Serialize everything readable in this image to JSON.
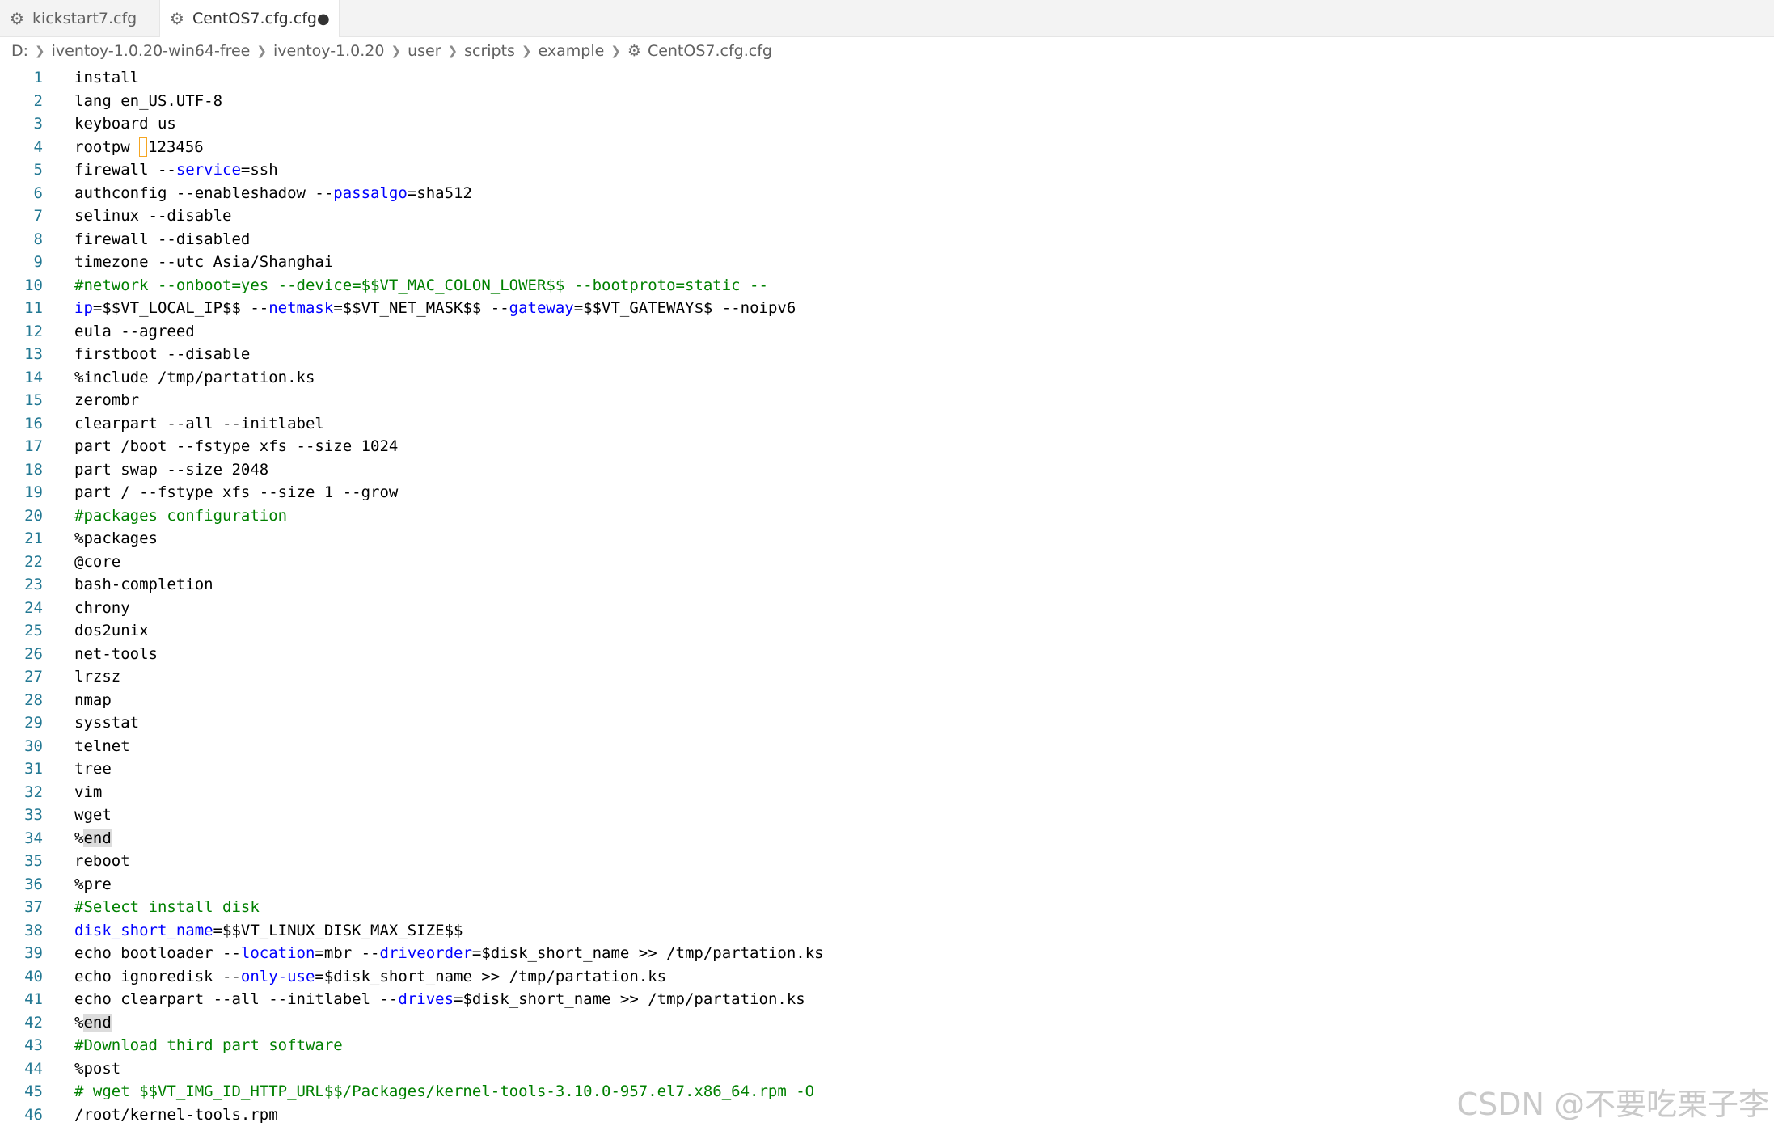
{
  "tabs": [
    {
      "label": "kickstart7.cfg",
      "icon": "gear-icon",
      "active": false
    },
    {
      "label": "CentOS7.cfg.cfg",
      "icon": "gear-icon",
      "active": true,
      "dirty_marker": "●"
    }
  ],
  "breadcrumb": [
    "D:",
    "iventoy-1.0.20-win64-free",
    "iventoy-1.0.20",
    "user",
    "scripts",
    "example",
    "CentOS7.cfg.cfg"
  ],
  "editor": {
    "lines": [
      [
        {
          "t": "install"
        }
      ],
      [
        {
          "t": "lang en_US.UTF-8"
        }
      ],
      [
        {
          "t": "keyboard us"
        }
      ],
      [
        {
          "t": "rootpw "
        },
        {
          "cursor": true
        },
        {
          "t": "123456"
        }
      ],
      [
        {
          "t": "firewall --"
        },
        {
          "t": "service",
          "c": "k"
        },
        {
          "t": "=ssh"
        }
      ],
      [
        {
          "t": "authconfig --enableshadow --"
        },
        {
          "t": "passalgo",
          "c": "k"
        },
        {
          "t": "=sha512"
        }
      ],
      [
        {
          "t": "selinux --disable"
        }
      ],
      [
        {
          "t": "firewall --disabled"
        }
      ],
      [
        {
          "t": "timezone --utc Asia/Shanghai"
        }
      ],
      [
        {
          "t": "#network --onboot=yes --device=$$VT_MAC_COLON_LOWER$$ --bootproto=static --",
          "c": "c"
        }
      ],
      [
        {
          "t": "ip",
          "c": "k"
        },
        {
          "t": "=$$VT_LOCAL_IP$$ --"
        },
        {
          "t": "netmask",
          "c": "k"
        },
        {
          "t": "=$$VT_NET_MASK$$ --"
        },
        {
          "t": "gateway",
          "c": "k"
        },
        {
          "t": "=$$VT_GATEWAY$$ --noipv6"
        }
      ],
      [
        {
          "t": "eula --agreed"
        }
      ],
      [
        {
          "t": "firstboot --disable"
        }
      ],
      [
        {
          "t": "%include /tmp/partation.ks"
        }
      ],
      [
        {
          "t": "zerombr"
        }
      ],
      [
        {
          "t": "clearpart --all --initlabel"
        }
      ],
      [
        {
          "t": "part /boot --fstype xfs --size 1024"
        }
      ],
      [
        {
          "t": "part swap --size 2048"
        }
      ],
      [
        {
          "t": "part / --fstype xfs --size 1 --grow"
        }
      ],
      [
        {
          "t": "#packages configuration",
          "c": "c"
        }
      ],
      [
        {
          "t": "%packages"
        }
      ],
      [
        {
          "t": "@core"
        }
      ],
      [
        {
          "t": "bash-completion"
        }
      ],
      [
        {
          "t": "chrony"
        }
      ],
      [
        {
          "t": "dos2unix"
        }
      ],
      [
        {
          "t": "net-tools"
        }
      ],
      [
        {
          "t": "lrzsz"
        }
      ],
      [
        {
          "t": "nmap"
        }
      ],
      [
        {
          "t": "sysstat"
        }
      ],
      [
        {
          "t": "telnet"
        }
      ],
      [
        {
          "t": "tree"
        }
      ],
      [
        {
          "t": "vim"
        }
      ],
      [
        {
          "t": "wget"
        }
      ],
      [
        {
          "t": "%"
        },
        {
          "t": "end",
          "c": "hl"
        }
      ],
      [
        {
          "t": "reboot"
        }
      ],
      [
        {
          "t": "%pre"
        }
      ],
      [
        {
          "t": "#Select install disk",
          "c": "c"
        }
      ],
      [
        {
          "t": "disk_short_name",
          "c": "k"
        },
        {
          "t": "=$$VT_LINUX_DISK_MAX_SIZE$$"
        }
      ],
      [
        {
          "t": "echo bootloader --"
        },
        {
          "t": "location",
          "c": "k"
        },
        {
          "t": "=mbr --"
        },
        {
          "t": "driveorder",
          "c": "k"
        },
        {
          "t": "=$disk_short_name >> /tmp/partation.ks"
        }
      ],
      [
        {
          "t": "echo ignoredisk --"
        },
        {
          "t": "only-use",
          "c": "k"
        },
        {
          "t": "=$disk_short_name >> /tmp/partation.ks"
        }
      ],
      [
        {
          "t": "echo clearpart --all --initlabel --"
        },
        {
          "t": "drives",
          "c": "k"
        },
        {
          "t": "=$disk_short_name >> /tmp/partation.ks"
        }
      ],
      [
        {
          "t": "%"
        },
        {
          "t": "end",
          "c": "hl"
        }
      ],
      [
        {
          "t": "#Download third part software",
          "c": "c"
        }
      ],
      [
        {
          "t": "%post"
        }
      ],
      [
        {
          "t": "# wget $$VT_IMG_ID_HTTP_URL$$/Packages/kernel-tools-3.10.0-957.el7.x86_64.rpm -O",
          "c": "c"
        }
      ],
      [
        {
          "t": "/root/kernel-tools.rpm"
        }
      ]
    ]
  },
  "watermark": "CSDN @不要吃栗子李",
  "colors": {
    "keyword": "#0000ff",
    "comment": "#008000",
    "line_number": "#237893",
    "highlight": "#dcdcdc"
  }
}
